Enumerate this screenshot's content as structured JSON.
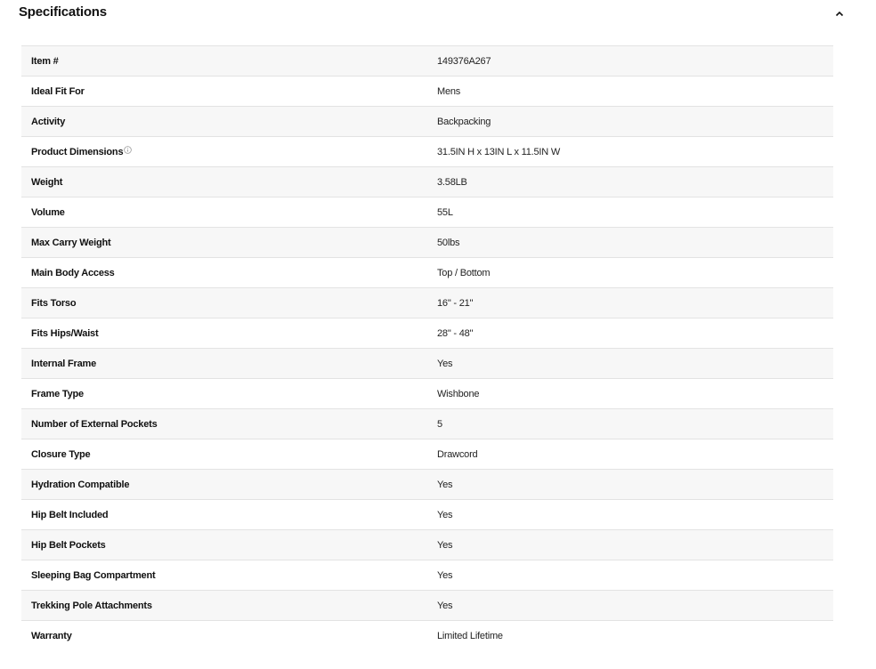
{
  "section": {
    "title": "Specifications",
    "toggle_icon": "chevron-up-icon"
  },
  "specs": [
    {
      "label": "Item #",
      "value": "149376A267"
    },
    {
      "label": "Ideal Fit For",
      "value": "Mens"
    },
    {
      "label": "Activity",
      "value": "Backpacking"
    },
    {
      "label": "Product Dimensions",
      "value": "31.5IN H x 13IN L x 11.5IN W",
      "icon": "info-icon"
    },
    {
      "label": "Weight",
      "value": "3.58LB"
    },
    {
      "label": "Volume",
      "value": "55L"
    },
    {
      "label": "Max Carry Weight",
      "value": "50lbs"
    },
    {
      "label": "Main Body Access",
      "value": "Top / Bottom"
    },
    {
      "label": "Fits Torso",
      "value": "16\" - 21\""
    },
    {
      "label": "Fits Hips/Waist",
      "value": "28\" - 48\""
    },
    {
      "label": "Internal Frame",
      "value": "Yes"
    },
    {
      "label": "Frame Type",
      "value": "Wishbone"
    },
    {
      "label": "Number of External Pockets",
      "value": "5"
    },
    {
      "label": "Closure Type",
      "value": "Drawcord"
    },
    {
      "label": "Hydration Compatible",
      "value": "Yes"
    },
    {
      "label": "Hip Belt Included",
      "value": "Yes"
    },
    {
      "label": "Hip Belt Pockets",
      "value": "Yes"
    },
    {
      "label": "Sleeping Bag Compartment",
      "value": "Yes"
    },
    {
      "label": "Trekking Pole Attachments",
      "value": "Yes"
    },
    {
      "label": "Warranty",
      "value": "Limited Lifetime"
    }
  ]
}
